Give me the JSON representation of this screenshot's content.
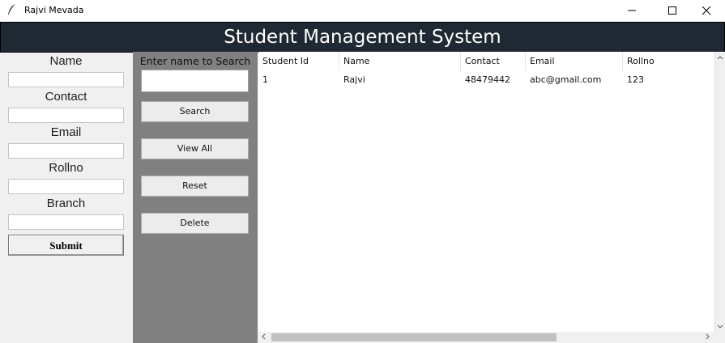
{
  "window": {
    "title": "Rajvi Mevada",
    "icons": [
      "feather-icon",
      "minimize-icon",
      "maximize-icon",
      "close-icon"
    ]
  },
  "header": {
    "title": "Student Management System"
  },
  "form": {
    "fields": [
      {
        "label": "Name",
        "value": ""
      },
      {
        "label": "Contact",
        "value": ""
      },
      {
        "label": "Email",
        "value": ""
      },
      {
        "label": "Rollno",
        "value": ""
      },
      {
        "label": "Branch",
        "value": ""
      }
    ],
    "submit_label": "Submit"
  },
  "search": {
    "label": "Enter name to Search",
    "value": "",
    "buttons": [
      "Search",
      "View All",
      "Reset",
      "Delete"
    ]
  },
  "table": {
    "columns": [
      "Student Id",
      "Name",
      "Contact",
      "Email",
      "Rollno"
    ],
    "rows": [
      [
        "1",
        "Rajvi",
        "48479442",
        "abc@gmail.com",
        "123"
      ]
    ]
  },
  "colors": {
    "header_bg": "#1f2933",
    "panel_bg": "#808080",
    "form_bg": "#f0f0f0",
    "table_bg": "#ffffff"
  }
}
